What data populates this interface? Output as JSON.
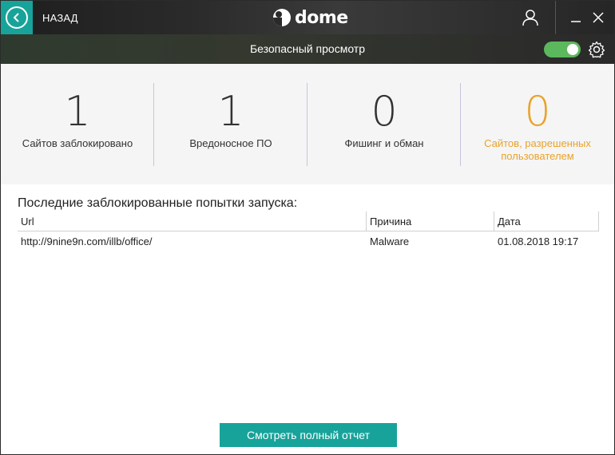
{
  "titlebar": {
    "back_label": "НАЗАД",
    "logo_text": "dome"
  },
  "subheader": {
    "title": "Безопасный просмотр",
    "toggle_on": true
  },
  "stats": [
    {
      "value": "1",
      "label": "Сайтов заблокировано"
    },
    {
      "value": "1",
      "label": "Вредоносное ПО"
    },
    {
      "value": "0",
      "label": "Фишинг и обман"
    },
    {
      "value": "0",
      "label": "Сайтов, разрешенных пользователем"
    }
  ],
  "table": {
    "title": "Последние заблокированные попытки запуска:",
    "columns": [
      "Url",
      "Причина",
      "Дата"
    ],
    "rows": [
      [
        "http://9nine9n.com/illb/office/",
        "Malware",
        "01.08.2018 19:17"
      ]
    ]
  },
  "report_button": "Смотреть полный отчет",
  "colors": {
    "accent": "#17a39a",
    "toggle": "#5cb85c",
    "highlight": "#e8a32a"
  }
}
